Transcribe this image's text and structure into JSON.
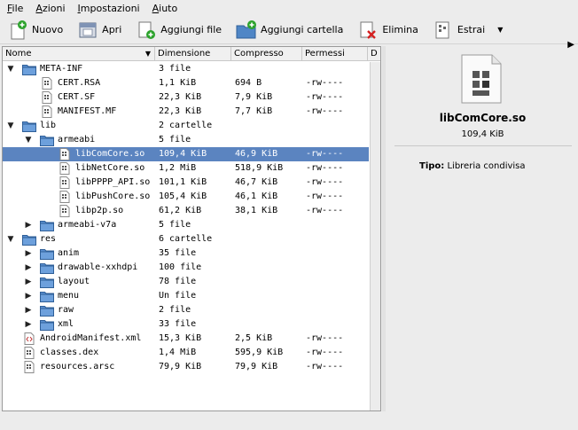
{
  "menubar": {
    "items": [
      {
        "label": "File",
        "u": "F",
        "rest": "ile"
      },
      {
        "label": "Azioni",
        "u": "A",
        "rest": "zioni"
      },
      {
        "label": "Impostazioni",
        "u": "I",
        "rest": "mpostazioni"
      },
      {
        "label": "Aiuto",
        "u": "A",
        "rest": "iuto"
      }
    ]
  },
  "toolbar": {
    "new_label": "Nuovo",
    "open_label": "Apri",
    "add_files_label": "Aggiungi file",
    "add_folder_label": "Aggiungi cartella",
    "delete_label": "Elimina",
    "extract_label": "Estrai"
  },
  "columns": {
    "name": "Nome",
    "size": "Dimensione",
    "compressed": "Compresso",
    "perms": "Permessi",
    "d": "D"
  },
  "rows": [
    {
      "name": "META-INF",
      "size": "3 file",
      "comp": "",
      "perms": "",
      "type": "folder",
      "level": 0,
      "exp": "open"
    },
    {
      "name": "CERT.RSA",
      "size": "1,1 KiB",
      "comp": "694 B",
      "perms": "-rw----",
      "type": "file",
      "level": 1,
      "exp": ""
    },
    {
      "name": "CERT.SF",
      "size": "22,3 KiB",
      "comp": "7,9 KiB",
      "perms": "-rw----",
      "type": "file",
      "level": 1,
      "exp": ""
    },
    {
      "name": "MANIFEST.MF",
      "size": "22,3 KiB",
      "comp": "7,7 KiB",
      "perms": "-rw----",
      "type": "file",
      "level": 1,
      "exp": ""
    },
    {
      "name": "lib",
      "size": "2 cartelle",
      "comp": "",
      "perms": "",
      "type": "folder",
      "level": 0,
      "exp": "open"
    },
    {
      "name": "armeabi",
      "size": "5 file",
      "comp": "",
      "perms": "",
      "type": "folder",
      "level": 1,
      "exp": "open"
    },
    {
      "name": "libComCore.so",
      "size": "109,4 KiB",
      "comp": "46,9 KiB",
      "perms": "-rw----",
      "type": "file",
      "level": 2,
      "exp": "",
      "selected": true
    },
    {
      "name": "libNetCore.so",
      "size": "1,2 MiB",
      "comp": "518,9 KiB",
      "perms": "-rw----",
      "type": "file",
      "level": 2,
      "exp": ""
    },
    {
      "name": "libPPPP_API.so",
      "size": "101,1 KiB",
      "comp": "46,7 KiB",
      "perms": "-rw----",
      "type": "file",
      "level": 2,
      "exp": ""
    },
    {
      "name": "libPushCore.so",
      "size": "105,4 KiB",
      "comp": "46,1 KiB",
      "perms": "-rw----",
      "type": "file",
      "level": 2,
      "exp": ""
    },
    {
      "name": "libp2p.so",
      "size": "61,2 KiB",
      "comp": "38,1 KiB",
      "perms": "-rw----",
      "type": "file",
      "level": 2,
      "exp": ""
    },
    {
      "name": "armeabi-v7a",
      "size": "5 file",
      "comp": "",
      "perms": "",
      "type": "folder",
      "level": 1,
      "exp": "closed"
    },
    {
      "name": "res",
      "size": "6 cartelle",
      "comp": "",
      "perms": "",
      "type": "folder",
      "level": 0,
      "exp": "open"
    },
    {
      "name": "anim",
      "size": "35 file",
      "comp": "",
      "perms": "",
      "type": "folder",
      "level": 1,
      "exp": "closed"
    },
    {
      "name": "drawable-xxhdpi",
      "size": "100 file",
      "comp": "",
      "perms": "",
      "type": "folder",
      "level": 1,
      "exp": "closed"
    },
    {
      "name": "layout",
      "size": "78 file",
      "comp": "",
      "perms": "",
      "type": "folder",
      "level": 1,
      "exp": "closed"
    },
    {
      "name": "menu",
      "size": "Un file",
      "comp": "",
      "perms": "",
      "type": "folder",
      "level": 1,
      "exp": "closed"
    },
    {
      "name": "raw",
      "size": "2 file",
      "comp": "",
      "perms": "",
      "type": "folder",
      "level": 1,
      "exp": "closed"
    },
    {
      "name": "xml",
      "size": "33 file",
      "comp": "",
      "perms": "",
      "type": "folder",
      "level": 1,
      "exp": "closed"
    },
    {
      "name": "AndroidManifest.xml",
      "size": "15,3 KiB",
      "comp": "2,5 KiB",
      "perms": "-rw----",
      "type": "xml",
      "level": 0,
      "exp": ""
    },
    {
      "name": "classes.dex",
      "size": "1,4 MiB",
      "comp": "595,9 KiB",
      "perms": "-rw----",
      "type": "file",
      "level": 0,
      "exp": ""
    },
    {
      "name": "resources.arsc",
      "size": "79,9 KiB",
      "comp": "79,9 KiB",
      "perms": "-rw----",
      "type": "file",
      "level": 0,
      "exp": ""
    }
  ],
  "side": {
    "name": "libComCore.so",
    "size": "109,4 KiB",
    "type_label": "Tipo:",
    "type_value": "Libreria condivisa"
  },
  "colors": {
    "selection": "#5b84c0",
    "folder": "#5a8fd0"
  }
}
